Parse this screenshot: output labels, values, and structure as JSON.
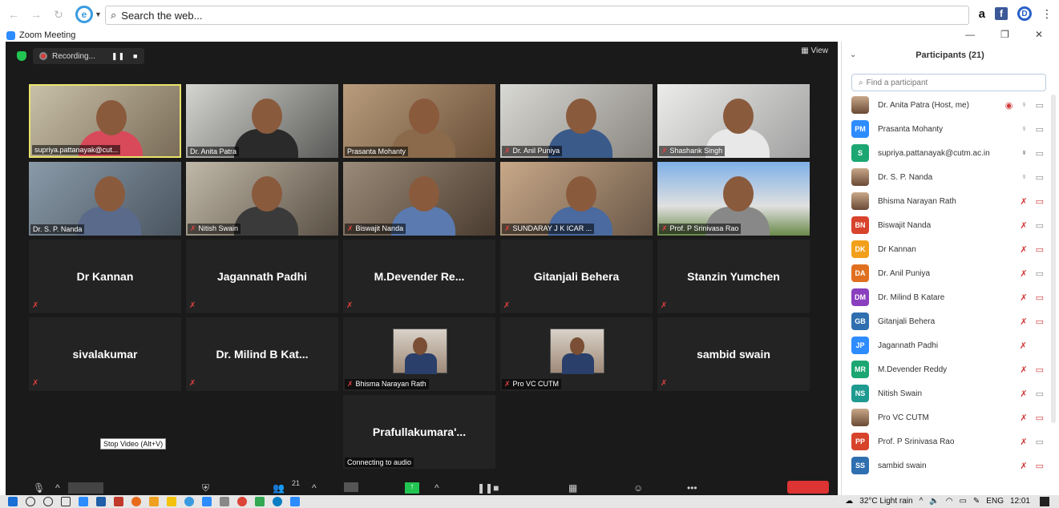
{
  "browser": {
    "search_placeholder": "Search the web...",
    "amazon_label": "a",
    "facebook_label": "f",
    "ext_label": "D",
    "menu_label": "⋮"
  },
  "window": {
    "title": "Zoom Meeting",
    "minimize": "—",
    "restore": "❐",
    "close": "✕"
  },
  "meeting": {
    "recording_label": "Recording...",
    "view_label": "View",
    "tooltip": "Stop Video (Alt+V)",
    "participant_count": "21",
    "connecting_label": "Connecting to audio"
  },
  "tiles": [
    {
      "name": "supriya.pattanayak@cut...",
      "kind": "video",
      "muted": false,
      "active": true
    },
    {
      "name": "Dr. Anita Patra",
      "kind": "video",
      "muted": false
    },
    {
      "name": "Prasanta Mohanty",
      "kind": "video",
      "muted": false
    },
    {
      "name": "Dr. Anil Puniya",
      "kind": "video",
      "muted": true
    },
    {
      "name": "Shashank Singh",
      "kind": "video",
      "muted": true
    },
    {
      "name": "Dr. S. P. Nanda",
      "kind": "video",
      "muted": false
    },
    {
      "name": "Nitish Swain",
      "kind": "video",
      "muted": true
    },
    {
      "name": "Biswajit Nanda",
      "kind": "video",
      "muted": true
    },
    {
      "name": "SUNDARAY J K ICAR ...",
      "kind": "video",
      "muted": true
    },
    {
      "name": "Prof. P Srinivasa Rao",
      "kind": "video",
      "muted": true
    },
    {
      "name": "Dr Kannan",
      "kind": "name",
      "muted": true
    },
    {
      "name": "Jagannath Padhi",
      "kind": "name",
      "muted": true
    },
    {
      "name": "M.Devender  Re...",
      "kind": "name",
      "muted": true
    },
    {
      "name": "Gitanjali Behera",
      "kind": "name",
      "muted": true
    },
    {
      "name": "Stanzin Yumchen",
      "kind": "name",
      "muted": true
    },
    {
      "name": "sivalakumar",
      "kind": "name",
      "muted": true
    },
    {
      "name": "Dr. Milind  B  Kat...",
      "kind": "name",
      "muted": true
    },
    {
      "name": "Bhisma Narayan Rath",
      "kind": "photo",
      "muted": true
    },
    {
      "name": "Pro VC CUTM",
      "kind": "photo",
      "muted": true
    },
    {
      "name": "sambid swain",
      "kind": "name",
      "muted": true
    },
    {
      "name": "Prafullakumara'...",
      "kind": "name",
      "muted": false
    }
  ],
  "panel": {
    "title": "Participants (21)",
    "find_placeholder": "Find a participant",
    "participants": [
      {
        "initials": "",
        "name": "Dr. Anita Patra (Host, me)",
        "color": "",
        "photo": true,
        "rec": true,
        "mic": "on",
        "cam": "on"
      },
      {
        "initials": "PM",
        "name": "Prasanta Mohanty",
        "color": "#2d8cff",
        "mic": "on",
        "cam": "on"
      },
      {
        "initials": "S",
        "name": "supriya.pattanayak@cutm.ac.in",
        "color": "#1ba672",
        "mic": "active",
        "cam": "on"
      },
      {
        "initials": "",
        "name": "Dr. S. P. Nanda",
        "color": "",
        "photo": true,
        "mic": "on",
        "cam": "on"
      },
      {
        "initials": "",
        "name": "Bhisma Narayan Rath",
        "color": "",
        "photo": true,
        "mic": "off",
        "cam": "off"
      },
      {
        "initials": "BN",
        "name": "Biswajit Nanda",
        "color": "#d8432c",
        "mic": "off",
        "cam": "on"
      },
      {
        "initials": "DK",
        "name": "Dr Kannan",
        "color": "#f2a01b",
        "mic": "off",
        "cam": "off"
      },
      {
        "initials": "DA",
        "name": "Dr. Anil Puniya",
        "color": "#e07020",
        "mic": "off",
        "cam": "on"
      },
      {
        "initials": "DM",
        "name": "Dr. Milind B Katare",
        "color": "#8a3fbf",
        "mic": "off",
        "cam": "off"
      },
      {
        "initials": "GB",
        "name": "Gitanjali Behera",
        "color": "#2f6fb0",
        "mic": "off",
        "cam": "off"
      },
      {
        "initials": "JP",
        "name": "Jagannath Padhi",
        "color": "#2d8cff",
        "mic": "off",
        "cam": "none"
      },
      {
        "initials": "MR",
        "name": "M.Devender Reddy",
        "color": "#1ba672",
        "mic": "off",
        "cam": "off"
      },
      {
        "initials": "NS",
        "name": "Nitish Swain",
        "color": "#1e9a90",
        "mic": "off",
        "cam": "on"
      },
      {
        "initials": "",
        "name": "Pro VC CUTM",
        "color": "",
        "photo": true,
        "mic": "off",
        "cam": "off"
      },
      {
        "initials": "PP",
        "name": "Prof. P Srinivasa Rao",
        "color": "#d8432c",
        "mic": "off",
        "cam": "on"
      },
      {
        "initials": "SS",
        "name": "sambid swain",
        "color": "#2f6fb0",
        "mic": "off",
        "cam": "off"
      }
    ]
  },
  "taskbar": {
    "weather": "32°C  Light rain",
    "lang": "ENG",
    "time": "12:01"
  }
}
